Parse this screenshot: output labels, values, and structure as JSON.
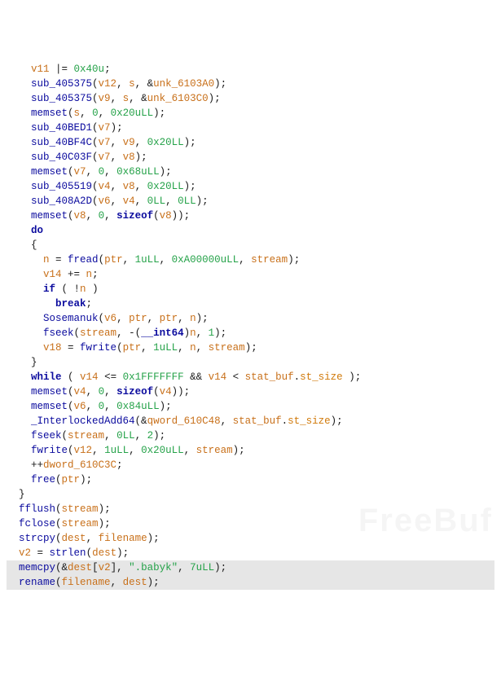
{
  "lines": [
    {
      "indent": "    ",
      "tokens": [
        {
          "c": "var",
          "t": "v11"
        },
        {
          "c": "punc",
          "t": " |= "
        },
        {
          "c": "num",
          "t": "0x40u"
        },
        {
          "c": "punc",
          "t": ";"
        }
      ]
    },
    {
      "indent": "    ",
      "tokens": [
        {
          "c": "fn",
          "t": "sub_405375"
        },
        {
          "c": "punc",
          "t": "("
        },
        {
          "c": "var",
          "t": "v12"
        },
        {
          "c": "punc",
          "t": ", "
        },
        {
          "c": "var",
          "t": "s"
        },
        {
          "c": "punc",
          "t": ", &"
        },
        {
          "c": "var",
          "t": "unk_6103A0"
        },
        {
          "c": "punc",
          "t": ");"
        }
      ]
    },
    {
      "indent": "    ",
      "tokens": [
        {
          "c": "fn",
          "t": "sub_405375"
        },
        {
          "c": "punc",
          "t": "("
        },
        {
          "c": "var",
          "t": "v9"
        },
        {
          "c": "punc",
          "t": ", "
        },
        {
          "c": "var",
          "t": "s"
        },
        {
          "c": "punc",
          "t": ", &"
        },
        {
          "c": "var",
          "t": "unk_6103C0"
        },
        {
          "c": "punc",
          "t": ");"
        }
      ]
    },
    {
      "indent": "    ",
      "tokens": [
        {
          "c": "fn",
          "t": "memset"
        },
        {
          "c": "punc",
          "t": "("
        },
        {
          "c": "var",
          "t": "s"
        },
        {
          "c": "punc",
          "t": ", "
        },
        {
          "c": "num",
          "t": "0"
        },
        {
          "c": "punc",
          "t": ", "
        },
        {
          "c": "num",
          "t": "0x20uLL"
        },
        {
          "c": "punc",
          "t": ");"
        }
      ]
    },
    {
      "indent": "    ",
      "tokens": [
        {
          "c": "fn",
          "t": "sub_40BED1"
        },
        {
          "c": "punc",
          "t": "("
        },
        {
          "c": "var",
          "t": "v7"
        },
        {
          "c": "punc",
          "t": ");"
        }
      ]
    },
    {
      "indent": "    ",
      "tokens": [
        {
          "c": "fn",
          "t": "sub_40BF4C"
        },
        {
          "c": "punc",
          "t": "("
        },
        {
          "c": "var",
          "t": "v7"
        },
        {
          "c": "punc",
          "t": ", "
        },
        {
          "c": "var",
          "t": "v9"
        },
        {
          "c": "punc",
          "t": ", "
        },
        {
          "c": "num",
          "t": "0x20LL"
        },
        {
          "c": "punc",
          "t": ");"
        }
      ]
    },
    {
      "indent": "    ",
      "tokens": [
        {
          "c": "fn",
          "t": "sub_40C03F"
        },
        {
          "c": "punc",
          "t": "("
        },
        {
          "c": "var",
          "t": "v7"
        },
        {
          "c": "punc",
          "t": ", "
        },
        {
          "c": "var",
          "t": "v8"
        },
        {
          "c": "punc",
          "t": ");"
        }
      ]
    },
    {
      "indent": "    ",
      "tokens": [
        {
          "c": "fn",
          "t": "memset"
        },
        {
          "c": "punc",
          "t": "("
        },
        {
          "c": "var",
          "t": "v7"
        },
        {
          "c": "punc",
          "t": ", "
        },
        {
          "c": "num",
          "t": "0"
        },
        {
          "c": "punc",
          "t": ", "
        },
        {
          "c": "num",
          "t": "0x68uLL"
        },
        {
          "c": "punc",
          "t": ");"
        }
      ]
    },
    {
      "indent": "    ",
      "tokens": [
        {
          "c": "fn",
          "t": "sub_405519"
        },
        {
          "c": "punc",
          "t": "("
        },
        {
          "c": "var",
          "t": "v4"
        },
        {
          "c": "punc",
          "t": ", "
        },
        {
          "c": "var",
          "t": "v8"
        },
        {
          "c": "punc",
          "t": ", "
        },
        {
          "c": "num",
          "t": "0x20LL"
        },
        {
          "c": "punc",
          "t": ");"
        }
      ]
    },
    {
      "indent": "    ",
      "tokens": [
        {
          "c": "fn",
          "t": "sub_408A2D"
        },
        {
          "c": "punc",
          "t": "("
        },
        {
          "c": "var",
          "t": "v6"
        },
        {
          "c": "punc",
          "t": ", "
        },
        {
          "c": "var",
          "t": "v4"
        },
        {
          "c": "punc",
          "t": ", "
        },
        {
          "c": "num",
          "t": "0LL"
        },
        {
          "c": "punc",
          "t": ", "
        },
        {
          "c": "num",
          "t": "0LL"
        },
        {
          "c": "punc",
          "t": ");"
        }
      ]
    },
    {
      "indent": "    ",
      "tokens": [
        {
          "c": "fn",
          "t": "memset"
        },
        {
          "c": "punc",
          "t": "("
        },
        {
          "c": "var",
          "t": "v8"
        },
        {
          "c": "punc",
          "t": ", "
        },
        {
          "c": "num",
          "t": "0"
        },
        {
          "c": "punc",
          "t": ", "
        },
        {
          "c": "kw",
          "t": "sizeof"
        },
        {
          "c": "punc",
          "t": "("
        },
        {
          "c": "var",
          "t": "v8"
        },
        {
          "c": "punc",
          "t": "));"
        }
      ]
    },
    {
      "indent": "    ",
      "tokens": [
        {
          "c": "kw",
          "t": "do"
        }
      ]
    },
    {
      "indent": "    ",
      "tokens": [
        {
          "c": "punc",
          "t": "{"
        }
      ]
    },
    {
      "indent": "      ",
      "tokens": [
        {
          "c": "var",
          "t": "n"
        },
        {
          "c": "punc",
          "t": " = "
        },
        {
          "c": "fn",
          "t": "fread"
        },
        {
          "c": "punc",
          "t": "("
        },
        {
          "c": "var",
          "t": "ptr"
        },
        {
          "c": "punc",
          "t": ", "
        },
        {
          "c": "num",
          "t": "1uLL"
        },
        {
          "c": "punc",
          "t": ", "
        },
        {
          "c": "num",
          "t": "0xA00000uLL"
        },
        {
          "c": "punc",
          "t": ", "
        },
        {
          "c": "var",
          "t": "stream"
        },
        {
          "c": "punc",
          "t": ");"
        }
      ]
    },
    {
      "indent": "      ",
      "tokens": [
        {
          "c": "var",
          "t": "v14"
        },
        {
          "c": "punc",
          "t": " += "
        },
        {
          "c": "var",
          "t": "n"
        },
        {
          "c": "punc",
          "t": ";"
        }
      ]
    },
    {
      "indent": "      ",
      "tokens": [
        {
          "c": "kw",
          "t": "if"
        },
        {
          "c": "punc",
          "t": " ( !"
        },
        {
          "c": "var",
          "t": "n"
        },
        {
          "c": "punc",
          "t": " )"
        }
      ]
    },
    {
      "indent": "        ",
      "tokens": [
        {
          "c": "kw",
          "t": "break"
        },
        {
          "c": "punc",
          "t": ";"
        }
      ]
    },
    {
      "indent": "      ",
      "tokens": [
        {
          "c": "fn",
          "t": "Sosemanuk"
        },
        {
          "c": "punc",
          "t": "("
        },
        {
          "c": "var",
          "t": "v6"
        },
        {
          "c": "punc",
          "t": ", "
        },
        {
          "c": "var",
          "t": "ptr"
        },
        {
          "c": "punc",
          "t": ", "
        },
        {
          "c": "var",
          "t": "ptr"
        },
        {
          "c": "punc",
          "t": ", "
        },
        {
          "c": "var",
          "t": "n"
        },
        {
          "c": "punc",
          "t": ");"
        }
      ]
    },
    {
      "indent": "      ",
      "tokens": [
        {
          "c": "fn",
          "t": "fseek"
        },
        {
          "c": "punc",
          "t": "("
        },
        {
          "c": "var",
          "t": "stream"
        },
        {
          "c": "punc",
          "t": ", -("
        },
        {
          "c": "kw",
          "t": "__int64"
        },
        {
          "c": "punc",
          "t": ")"
        },
        {
          "c": "var",
          "t": "n"
        },
        {
          "c": "punc",
          "t": ", "
        },
        {
          "c": "num",
          "t": "1"
        },
        {
          "c": "punc",
          "t": ");"
        }
      ]
    },
    {
      "indent": "      ",
      "tokens": [
        {
          "c": "var",
          "t": "v18"
        },
        {
          "c": "punc",
          "t": " = "
        },
        {
          "c": "fn",
          "t": "fwrite"
        },
        {
          "c": "punc",
          "t": "("
        },
        {
          "c": "var",
          "t": "ptr"
        },
        {
          "c": "punc",
          "t": ", "
        },
        {
          "c": "num",
          "t": "1uLL"
        },
        {
          "c": "punc",
          "t": ", "
        },
        {
          "c": "var",
          "t": "n"
        },
        {
          "c": "punc",
          "t": ", "
        },
        {
          "c": "var",
          "t": "stream"
        },
        {
          "c": "punc",
          "t": ");"
        }
      ]
    },
    {
      "indent": "    ",
      "tokens": [
        {
          "c": "punc",
          "t": "}"
        }
      ]
    },
    {
      "indent": "    ",
      "tokens": [
        {
          "c": "kw",
          "t": "while"
        },
        {
          "c": "punc",
          "t": " ( "
        },
        {
          "c": "var",
          "t": "v14"
        },
        {
          "c": "punc",
          "t": " <= "
        },
        {
          "c": "num",
          "t": "0x1FFFFFFF"
        },
        {
          "c": "punc",
          "t": " && "
        },
        {
          "c": "var",
          "t": "v14"
        },
        {
          "c": "punc",
          "t": " < "
        },
        {
          "c": "var",
          "t": "stat_buf"
        },
        {
          "c": "punc",
          "t": "."
        },
        {
          "c": "field",
          "t": "st_size"
        },
        {
          "c": "punc",
          "t": " );"
        }
      ]
    },
    {
      "indent": "    ",
      "tokens": [
        {
          "c": "fn",
          "t": "memset"
        },
        {
          "c": "punc",
          "t": "("
        },
        {
          "c": "var",
          "t": "v4"
        },
        {
          "c": "punc",
          "t": ", "
        },
        {
          "c": "num",
          "t": "0"
        },
        {
          "c": "punc",
          "t": ", "
        },
        {
          "c": "kw",
          "t": "sizeof"
        },
        {
          "c": "punc",
          "t": "("
        },
        {
          "c": "var",
          "t": "v4"
        },
        {
          "c": "punc",
          "t": "));"
        }
      ]
    },
    {
      "indent": "    ",
      "tokens": [
        {
          "c": "fn",
          "t": "memset"
        },
        {
          "c": "punc",
          "t": "("
        },
        {
          "c": "var",
          "t": "v6"
        },
        {
          "c": "punc",
          "t": ", "
        },
        {
          "c": "num",
          "t": "0"
        },
        {
          "c": "punc",
          "t": ", "
        },
        {
          "c": "num",
          "t": "0x84uLL"
        },
        {
          "c": "punc",
          "t": ");"
        }
      ]
    },
    {
      "indent": "    ",
      "tokens": [
        {
          "c": "fn",
          "t": "_InterlockedAdd64"
        },
        {
          "c": "punc",
          "t": "(&"
        },
        {
          "c": "var",
          "t": "qword_610C48"
        },
        {
          "c": "punc",
          "t": ", "
        },
        {
          "c": "var",
          "t": "stat_buf"
        },
        {
          "c": "punc",
          "t": "."
        },
        {
          "c": "field",
          "t": "st_size"
        },
        {
          "c": "punc",
          "t": ");"
        }
      ]
    },
    {
      "indent": "    ",
      "tokens": [
        {
          "c": "fn",
          "t": "fseek"
        },
        {
          "c": "punc",
          "t": "("
        },
        {
          "c": "var",
          "t": "stream"
        },
        {
          "c": "punc",
          "t": ", "
        },
        {
          "c": "num",
          "t": "0LL"
        },
        {
          "c": "punc",
          "t": ", "
        },
        {
          "c": "num",
          "t": "2"
        },
        {
          "c": "punc",
          "t": ");"
        }
      ]
    },
    {
      "indent": "    ",
      "tokens": [
        {
          "c": "fn",
          "t": "fwrite"
        },
        {
          "c": "punc",
          "t": "("
        },
        {
          "c": "var",
          "t": "v12"
        },
        {
          "c": "punc",
          "t": ", "
        },
        {
          "c": "num",
          "t": "1uLL"
        },
        {
          "c": "punc",
          "t": ", "
        },
        {
          "c": "num",
          "t": "0x20uLL"
        },
        {
          "c": "punc",
          "t": ", "
        },
        {
          "c": "var",
          "t": "stream"
        },
        {
          "c": "punc",
          "t": ");"
        }
      ]
    },
    {
      "indent": "    ",
      "tokens": [
        {
          "c": "punc",
          "t": "++"
        },
        {
          "c": "var",
          "t": "dword_610C3C"
        },
        {
          "c": "punc",
          "t": ";"
        }
      ]
    },
    {
      "indent": "    ",
      "tokens": [
        {
          "c": "fn",
          "t": "free"
        },
        {
          "c": "punc",
          "t": "("
        },
        {
          "c": "var",
          "t": "ptr"
        },
        {
          "c": "punc",
          "t": ");"
        }
      ]
    },
    {
      "indent": "  ",
      "tokens": [
        {
          "c": "punc",
          "t": "}"
        }
      ]
    },
    {
      "indent": "  ",
      "tokens": [
        {
          "c": "fn",
          "t": "fflush"
        },
        {
          "c": "punc",
          "t": "("
        },
        {
          "c": "var",
          "t": "stream"
        },
        {
          "c": "punc",
          "t": ");"
        }
      ]
    },
    {
      "indent": "  ",
      "tokens": [
        {
          "c": "fn",
          "t": "fclose"
        },
        {
          "c": "punc",
          "t": "("
        },
        {
          "c": "var",
          "t": "stream"
        },
        {
          "c": "punc",
          "t": ");"
        }
      ]
    },
    {
      "indent": "  ",
      "tokens": [
        {
          "c": "fn",
          "t": "strcpy"
        },
        {
          "c": "punc",
          "t": "("
        },
        {
          "c": "var",
          "t": "dest"
        },
        {
          "c": "punc",
          "t": ", "
        },
        {
          "c": "var",
          "t": "filename"
        },
        {
          "c": "punc",
          "t": ");"
        }
      ]
    },
    {
      "indent": "  ",
      "tokens": [
        {
          "c": "var",
          "t": "v2"
        },
        {
          "c": "punc",
          "t": " = "
        },
        {
          "c": "fn",
          "t": "strlen"
        },
        {
          "c": "punc",
          "t": "("
        },
        {
          "c": "var",
          "t": "dest"
        },
        {
          "c": "punc",
          "t": ");"
        }
      ]
    },
    {
      "indent": "  ",
      "hl": true,
      "tokens": [
        {
          "c": "fn",
          "t": "memcpy"
        },
        {
          "c": "punc",
          "t": "(&"
        },
        {
          "c": "var",
          "t": "dest"
        },
        {
          "c": "punc",
          "t": "["
        },
        {
          "c": "var",
          "t": "v2"
        },
        {
          "c": "punc",
          "t": "], "
        },
        {
          "c": "str",
          "t": "\".babyk\""
        },
        {
          "c": "punc",
          "t": ", "
        },
        {
          "c": "num",
          "t": "7uLL"
        },
        {
          "c": "punc",
          "t": ");"
        }
      ]
    },
    {
      "indent": "  ",
      "hl": true,
      "tokens": [
        {
          "c": "fn",
          "t": "rename"
        },
        {
          "c": "punc",
          "t": "("
        },
        {
          "c": "var",
          "t": "filename"
        },
        {
          "c": "punc",
          "t": ", "
        },
        {
          "c": "var",
          "t": "dest"
        },
        {
          "c": "punc",
          "t": ");"
        }
      ]
    }
  ],
  "watermark": "FreeBuf"
}
